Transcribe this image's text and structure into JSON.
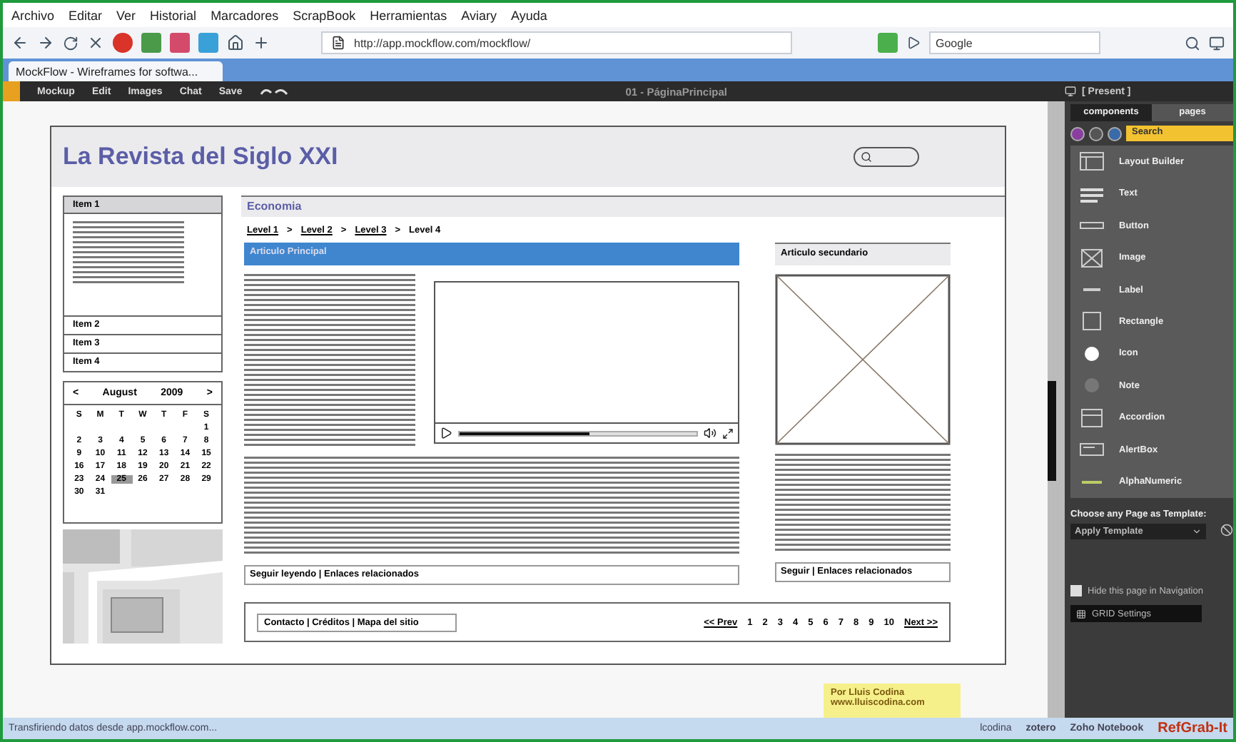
{
  "browser": {
    "menu": [
      "Archivo",
      "Editar",
      "Ver",
      "Historial",
      "Marcadores",
      "ScrapBook",
      "Herramientas",
      "Aviary",
      "Ayuda"
    ],
    "url": "http://app.mockflow.com/mockflow/",
    "search": "Google",
    "tabs": [
      {
        "label": "MockFlow - Wireframes for softwa...",
        "selected": true
      }
    ]
  },
  "app_toolbar": {
    "menu": [
      "Mockup",
      "Edit",
      "Images",
      "Chat",
      "Save"
    ],
    "title": "01 - PáginaPrincipal",
    "present": "[ Present ]"
  },
  "wireframe": {
    "title": "La Revista del Siglo XXI",
    "accordion": [
      {
        "label": "Item 1",
        "expanded": true
      },
      {
        "label": "Item 2",
        "expanded": false
      },
      {
        "label": "Item 3",
        "expanded": false
      },
      {
        "label": "Item 4",
        "expanded": false
      }
    ],
    "calendar": {
      "prev": "<",
      "month": "August",
      "year": "2009",
      "next": ">",
      "weekdays": [
        "S",
        "M",
        "T",
        "W",
        "T",
        "F",
        "S"
      ],
      "weeks": [
        [
          {
            "day": "1",
            "selected": false
          }
        ],
        [
          {
            "day": "2",
            "selected": false
          },
          {
            "day": "3",
            "selected": false
          },
          {
            "day": "4",
            "selected": false
          },
          {
            "day": "5",
            "selected": false
          },
          {
            "day": "6",
            "selected": false
          },
          {
            "day": "7",
            "selected": false
          },
          {
            "day": "8",
            "selected": false
          }
        ],
        [
          {
            "day": "9",
            "selected": false
          },
          {
            "day": "10",
            "selected": false
          },
          {
            "day": "11",
            "selected": false
          },
          {
            "day": "12",
            "selected": false
          },
          {
            "day": "13",
            "selected": false
          },
          {
            "day": "14",
            "selected": false
          },
          {
            "day": "15",
            "selected": false
          }
        ],
        [
          {
            "day": "16",
            "selected": false
          },
          {
            "day": "17",
            "selected": false
          },
          {
            "day": "18",
            "selected": false
          },
          {
            "day": "19",
            "selected": false
          },
          {
            "day": "20",
            "selected": false
          },
          {
            "day": "21",
            "selected": false
          },
          {
            "day": "22",
            "selected": false
          }
        ],
        [
          {
            "day": "23",
            "selected": false
          },
          {
            "day": "24",
            "selected": false
          },
          {
            "day": "25",
            "selected": true
          },
          {
            "day": "26",
            "selected": false
          },
          {
            "day": "27",
            "selected": false
          },
          {
            "day": "28",
            "selected": false
          },
          {
            "day": "29",
            "selected": false
          }
        ],
        [
          {
            "day": "30",
            "selected": false
          },
          {
            "day": "31",
            "selected": false
          }
        ]
      ]
    },
    "section": "Economia",
    "breadcrumbs": [
      {
        "kind": "link",
        "label": "Level 1"
      },
      {
        "kind": "separator",
        "label": ">"
      },
      {
        "kind": "link",
        "label": "Level 2"
      },
      {
        "kind": "separator",
        "label": ">"
      },
      {
        "kind": "link",
        "label": "Level 3"
      },
      {
        "kind": "separator",
        "label": ">"
      },
      {
        "kind": "current",
        "label": "Level 4"
      }
    ],
    "main_article": {
      "title": "Articulo Principal",
      "video": {
        "level": 0.55
      },
      "links": "Seguir leyendo | Enlaces relacionados"
    },
    "secondary_article": {
      "title": "Articulo secundario",
      "links": "Seguir | Enlaces relacionados"
    },
    "footer": {
      "links": "Contacto | Créditos | Mapa del sitio",
      "pagination": [
        {
          "kind": "nav",
          "label": "<< Prev"
        },
        {
          "kind": "page",
          "label": "1"
        },
        {
          "kind": "page",
          "label": "2"
        },
        {
          "kind": "page",
          "label": "3"
        },
        {
          "kind": "page",
          "label": "4"
        },
        {
          "kind": "page",
          "label": "5"
        },
        {
          "kind": "page",
          "label": "6"
        },
        {
          "kind": "page",
          "label": "7"
        },
        {
          "kind": "page",
          "label": "8"
        },
        {
          "kind": "page",
          "label": "9"
        },
        {
          "kind": "page",
          "label": "10"
        },
        {
          "kind": "nav",
          "label": "Next >>"
        }
      ]
    }
  },
  "note": [
    "Por Lluis Codina",
    "www.lluiscodina.com"
  ],
  "panel": {
    "tabs": [
      {
        "label": "components",
        "selected": true
      },
      {
        "label": "pages",
        "selected": false
      }
    ],
    "search": "Search",
    "components": [
      {
        "kind": "layout",
        "label": "Layout Builder"
      },
      {
        "kind": "text",
        "label": "Text"
      },
      {
        "kind": "button",
        "label": "Button"
      },
      {
        "kind": "image",
        "label": "Image"
      },
      {
        "kind": "label",
        "label": "Label"
      },
      {
        "kind": "rectangle",
        "label": "Rectangle"
      },
      {
        "kind": "icon",
        "label": "Icon"
      },
      {
        "kind": "note",
        "label": "Note"
      },
      {
        "kind": "accordion",
        "label": "Accordion"
      },
      {
        "kind": "alertbox",
        "label": "AlertBox"
      },
      {
        "kind": "alphanumeric",
        "label": "AlphaNumeric"
      }
    ],
    "template_label": "Choose any Page as Template:",
    "template_select": "Apply Template",
    "hide_nav": {
      "label": "Hide this page in Navigation",
      "checked": false
    },
    "grid_button": "GRID Settings"
  },
  "status_bar": {
    "text": "Transfiriendo datos desde app.mockflow.com...",
    "items": [
      "lcodina",
      "zotero",
      "Zoho Notebook",
      "RefGrab-It"
    ]
  }
}
